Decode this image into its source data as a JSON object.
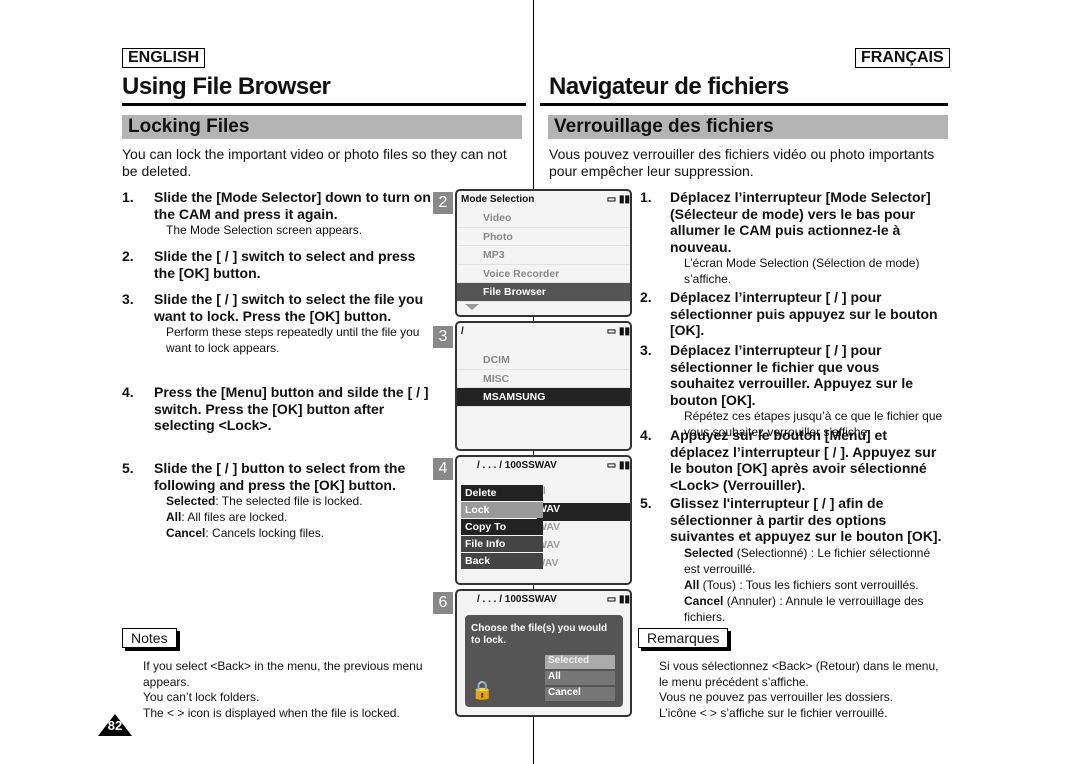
{
  "header": {
    "left_lang": "ENGLISH",
    "right_lang": "FRANÇAIS",
    "left_title": "Using File Browser",
    "right_title": "Navigateur de fichiers",
    "left_section": "Locking Files",
    "right_section": "Verrouillage des fichiers"
  },
  "left": {
    "intro": "You can lock the important video or photo files so they can not be deleted.",
    "steps": [
      {
        "n": "1.",
        "text": "Slide the [Mode Selector] down to turn on the CAM and press it again.",
        "sub": "The Mode Selection screen appears."
      },
      {
        "n": "2.",
        "text": "Slide the [ / ] switch to select and press the [OK] button."
      },
      {
        "n": "3.",
        "text": "Slide the [ / ] switch to select the file you want to lock. Press the [OK] button.",
        "sub": "Perform these steps repeatedly until the file you want to lock appears."
      },
      {
        "n": "4.",
        "text": "Press the [Menu] button and silde the [ / ] switch. Press the [OK] button after selecting <Lock>."
      },
      {
        "n": "5.",
        "text": "Slide the [ / ] button to select from the following and press the [OK] button.",
        "sub1b": "Selected",
        "sub1": ": The selected file is locked.",
        "sub2b": "All",
        "sub2": ": All files are locked.",
        "sub3b": "Cancel",
        "sub3": ": Cancels locking files."
      }
    ],
    "notes_label": "Notes",
    "notes": [
      "If you select <Back> in the menu, the previous menu appears.",
      "You can’t lock folders.",
      "The < > icon is displayed when the file is locked."
    ]
  },
  "right": {
    "intro": "Vous pouvez verrouiller des fichiers vidéo ou photo importants pour empêcher leur suppression.",
    "steps": [
      {
        "n": "1.",
        "text": "Déplacez l’interrupteur [Mode Selector] (Sélecteur de mode) vers le bas pour allumer le CAM puis actionnez-le à nouveau.",
        "sub": "L’écran Mode Selection (Sélection de mode) s’affiche."
      },
      {
        "n": "2.",
        "text": "Déplacez l’interrupteur [ / ] pour sélectionner puis appuyez sur le bouton [OK]."
      },
      {
        "n": "3.",
        "text": "Déplacez l’interrupteur [ / ] pour sélectionner le fichier que vous souhaitez verrouiller. Appuyez sur le bouton [OK].",
        "sub": "Répétez ces étapes jusqu’à ce que le fichier que vous souhaitez verrouiller s’affiche."
      },
      {
        "n": "4.",
        "text": "Appuyez sur le bouton [Menu] et déplacez l’interrupteur [ / ]. Appuyez sur le bouton [OK] après avoir sélectionné <Lock> (Verrouiller)."
      },
      {
        "n": "5.",
        "text": "Glissez l'interrupteur [ / ] afin de sélectionner à partir des options suivantes et appuyez sur le bouton [OK].",
        "sub1b": "Selected",
        "sub1": " (Selectionné) : Le fichier sélectionné est verrouillé.",
        "sub2b": "All",
        "sub2": " (Tous) : Tous les fichiers sont verrouillés.",
        "sub3b": "Cancel",
        "sub3": " (Annuler) : Annule le verrouillage des fichiers."
      }
    ],
    "notes_label": "Remarques",
    "notes": [
      "Si vous sélectionnez <Back> (Retour) dans le menu, le menu précédent s’affiche.",
      "Vous ne pouvez pas verrouiller les dossiers.",
      "L’icône < > s’affiche sur le fichier verrouillé."
    ]
  },
  "screens": {
    "s2": {
      "num": "2",
      "title": "Mode Selection",
      "items": [
        "Video",
        "Photo",
        "MP3",
        "Voice Recorder",
        "File Browser"
      ]
    },
    "s3": {
      "num": "3",
      "title": "/",
      "items": [
        "DCIM",
        "MISC",
        "MSAMSUNG"
      ]
    },
    "s4": {
      "num": "4",
      "title": "/ . . . / 100SSWAV",
      "menu": [
        "Delete",
        "Lock",
        "Copy To",
        "File Info",
        "Back"
      ],
      "behind": [
        "el",
        "WAV",
        "WAV",
        "WAV",
        "SWAV0004.WAV"
      ]
    },
    "s6": {
      "num": "6",
      "title": "/ . . . / 100SSWAV",
      "message": "Choose the file(s) you would to lock.",
      "options": [
        "Selected",
        "All",
        "Cancel"
      ]
    }
  },
  "page_number": "82"
}
